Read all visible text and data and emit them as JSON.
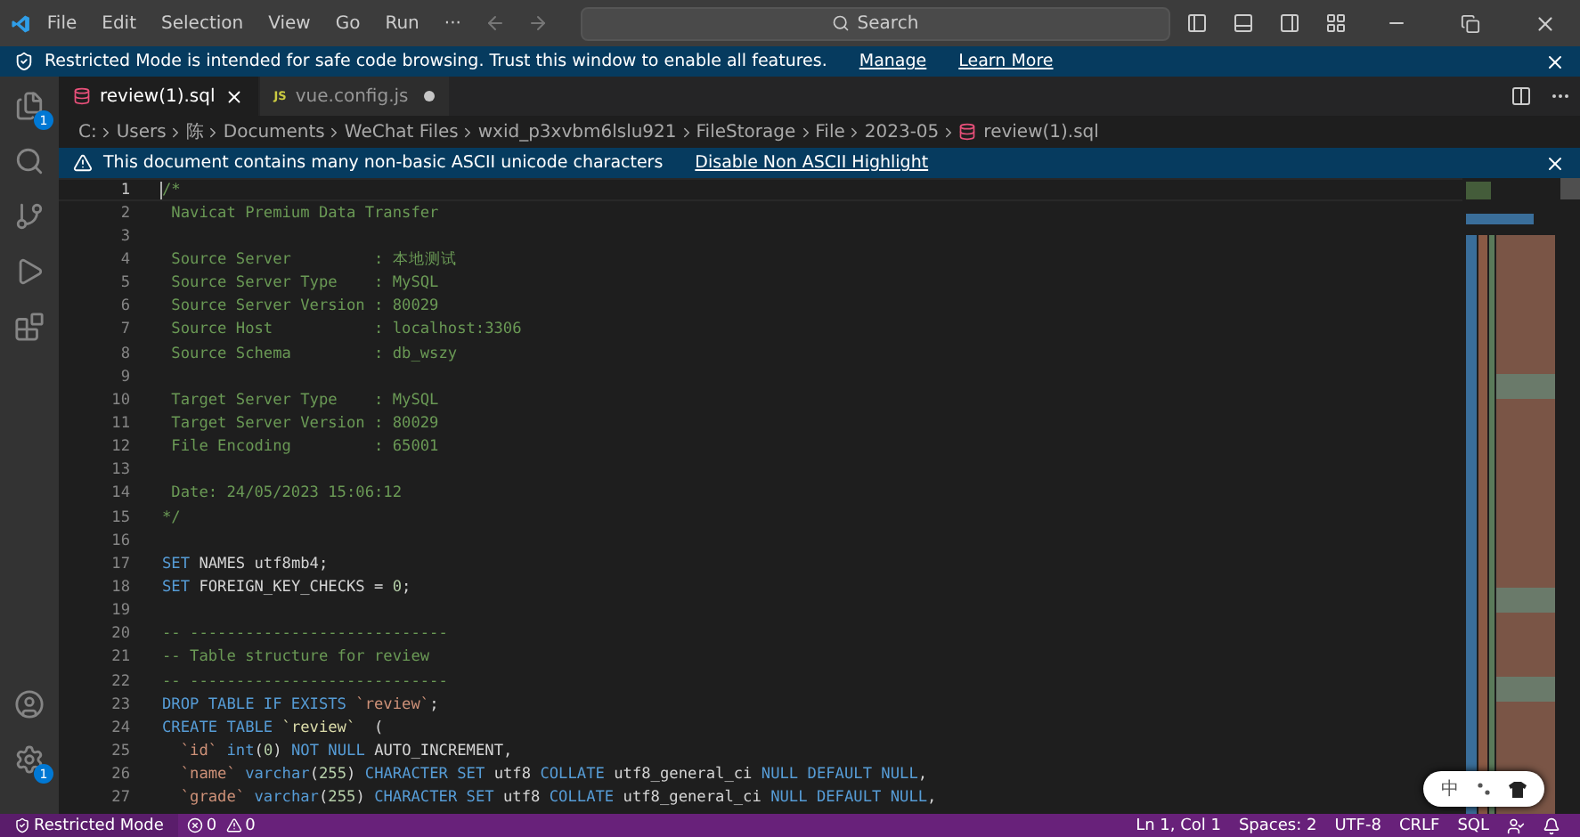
{
  "menu": [
    "File",
    "Edit",
    "Selection",
    "View",
    "Go",
    "Run",
    "···"
  ],
  "search": {
    "placeholder": "Search"
  },
  "restricted_banner": {
    "message": "Restricted Mode is intended for safe code browsing. Trust this window to enable all features.",
    "links": [
      "Manage",
      "Learn More"
    ]
  },
  "activity_bar": {
    "explorer_badge": "1",
    "settings_badge": "1"
  },
  "tabs": [
    {
      "label": "review(1).sql",
      "kind": "sql",
      "selected": true,
      "dirty": false
    },
    {
      "label": "vue.config.js",
      "kind": "js",
      "selected": false,
      "dirty": true
    }
  ],
  "js_icon_text": "JS",
  "breadcrumb": [
    "C:",
    "Users",
    "陈",
    "Documents",
    "WeChat Files",
    "wxid_p3xvbm6lslu921",
    "FileStorage",
    "File",
    "2023-05",
    "review(1).sql"
  ],
  "ascii_banner": {
    "message": "This document contains many non-basic ASCII unicode characters",
    "link": "Disable Non ASCII Highlight"
  },
  "code_lines": [
    {
      "number": "1",
      "selected": true,
      "tokens": [
        {
          "kind": "comment",
          "text": "/*"
        }
      ]
    },
    {
      "number": "2",
      "selected": false,
      "tokens": [
        {
          "kind": "comment",
          "text": " Navicat Premium Data Transfer"
        }
      ]
    },
    {
      "number": "3",
      "selected": false
    },
    {
      "number": "4",
      "selected": false,
      "tokens": [
        {
          "kind": "comment",
          "text": " Source Server         : 本地测试"
        }
      ]
    },
    {
      "number": "5",
      "selected": false,
      "tokens": [
        {
          "kind": "comment",
          "text": " Source Server Type    : MySQL"
        }
      ]
    },
    {
      "number": "6",
      "selected": false,
      "tokens": [
        {
          "kind": "comment",
          "text": " Source Server Version : 80029"
        }
      ]
    },
    {
      "number": "7",
      "selected": false,
      "tokens": [
        {
          "kind": "comment",
          "text": " Source Host           : localhost:3306"
        }
      ]
    },
    {
      "number": "8",
      "selected": false,
      "tokens": [
        {
          "kind": "comment",
          "text": " Source Schema         : db_wszy"
        }
      ]
    },
    {
      "number": "9",
      "selected": false
    },
    {
      "number": "10",
      "selected": false,
      "tokens": [
        {
          "kind": "comment",
          "text": " Target Server Type    : MySQL"
        }
      ]
    },
    {
      "number": "11",
      "selected": false,
      "tokens": [
        {
          "kind": "comment",
          "text": " Target Server Version : 80029"
        }
      ]
    },
    {
      "number": "12",
      "selected": false,
      "tokens": [
        {
          "kind": "comment",
          "text": " File Encoding         : 65001"
        }
      ]
    },
    {
      "number": "13",
      "selected": false
    },
    {
      "number": "14",
      "selected": false,
      "tokens": [
        {
          "kind": "comment",
          "text": " Date: 24/05/2023 15:06:12"
        }
      ]
    },
    {
      "number": "15",
      "selected": false,
      "tokens": [
        {
          "kind": "comment",
          "text": "*/"
        }
      ]
    },
    {
      "number": "16",
      "selected": false
    },
    {
      "number": "17",
      "selected": false,
      "tokens": [
        {
          "kind": "keyword",
          "text": "SET"
        },
        {
          "kind": "plain",
          "text": " NAMES utf8mb4;"
        }
      ]
    },
    {
      "number": "18",
      "selected": false,
      "tokens": [
        {
          "kind": "keyword",
          "text": "SET"
        },
        {
          "kind": "plain",
          "text": " FOREIGN_KEY_CHECKS = "
        },
        {
          "kind": "number",
          "text": "0"
        },
        {
          "kind": "plain",
          "text": ";"
        }
      ]
    },
    {
      "number": "19",
      "selected": false
    },
    {
      "number": "20",
      "selected": false,
      "tokens": [
        {
          "kind": "comment",
          "text": "-- ----------------------------"
        }
      ]
    },
    {
      "number": "21",
      "selected": false,
      "tokens": [
        {
          "kind": "comment",
          "text": "-- Table structure for review"
        }
      ]
    },
    {
      "number": "22",
      "selected": false,
      "tokens": [
        {
          "kind": "comment",
          "text": "-- ----------------------------"
        }
      ]
    },
    {
      "number": "23",
      "selected": false,
      "tokens": [
        {
          "kind": "keyword",
          "text": "DROP TABLE IF EXISTS"
        },
        {
          "kind": "string",
          "text": " `review`"
        },
        {
          "kind": "plain",
          "text": ";"
        }
      ]
    },
    {
      "number": "24",
      "selected": false,
      "tokens": [
        {
          "kind": "keyword",
          "text": "CREATE TABLE"
        },
        {
          "kind": "ident",
          "text": " `review`"
        },
        {
          "kind": "plain",
          "text": "  ("
        }
      ]
    },
    {
      "number": "25",
      "selected": false,
      "tokens": [
        {
          "kind": "string",
          "text": "  `id`"
        },
        {
          "kind": "keyword",
          "text": " int"
        },
        {
          "kind": "plain",
          "text": "("
        },
        {
          "kind": "number",
          "text": "0"
        },
        {
          "kind": "plain",
          "text": ")"
        },
        {
          "kind": "keyword",
          "text": " NOT NULL"
        },
        {
          "kind": "plain",
          "text": " AUTO_INCREMENT,"
        }
      ]
    },
    {
      "number": "26",
      "selected": false,
      "tokens": [
        {
          "kind": "string",
          "text": "  `name`"
        },
        {
          "kind": "keyword",
          "text": " varchar"
        },
        {
          "kind": "plain",
          "text": "("
        },
        {
          "kind": "number",
          "text": "255"
        },
        {
          "kind": "plain",
          "text": ")"
        },
        {
          "kind": "keyword",
          "text": " CHARACTER SET"
        },
        {
          "kind": "plain",
          "text": " utf8"
        },
        {
          "kind": "keyword",
          "text": " COLLATE"
        },
        {
          "kind": "plain",
          "text": " utf8_general_ci"
        },
        {
          "kind": "keyword",
          "text": " NULL DEFAULT NULL"
        },
        {
          "kind": "plain",
          "text": ","
        }
      ]
    },
    {
      "number": "27",
      "selected": false,
      "tokens": [
        {
          "kind": "string",
          "text": "  `grade`"
        },
        {
          "kind": "keyword",
          "text": " varchar"
        },
        {
          "kind": "plain",
          "text": "("
        },
        {
          "kind": "number",
          "text": "255"
        },
        {
          "kind": "plain",
          "text": ")"
        },
        {
          "kind": "keyword",
          "text": " CHARACTER SET"
        },
        {
          "kind": "plain",
          "text": " utf8"
        },
        {
          "kind": "keyword",
          "text": " COLLATE"
        },
        {
          "kind": "plain",
          "text": " utf8_general_ci"
        },
        {
          "kind": "keyword",
          "text": " NULL DEFAULT NULL"
        },
        {
          "kind": "plain",
          "text": ","
        }
      ]
    }
  ],
  "ime": {
    "label": "中"
  },
  "status_bar": {
    "mode": "Restricted Mode",
    "errors": "0",
    "warnings": "0",
    "right": [
      "Ln 1, Col 1",
      "Spaces: 2",
      "UTF-8",
      "CRLF",
      "SQL"
    ]
  }
}
